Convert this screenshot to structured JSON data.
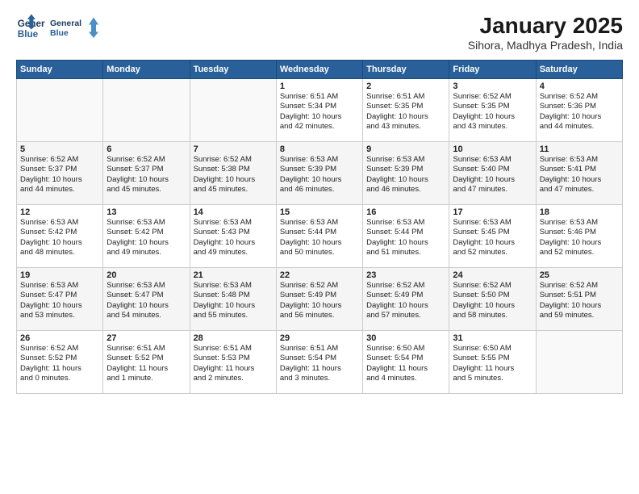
{
  "logo": {
    "line1": "General",
    "line2": "Blue"
  },
  "header": {
    "month_year": "January 2025",
    "location": "Sihora, Madhya Pradesh, India"
  },
  "days_of_week": [
    "Sunday",
    "Monday",
    "Tuesday",
    "Wednesday",
    "Thursday",
    "Friday",
    "Saturday"
  ],
  "weeks": [
    [
      {
        "day": "",
        "info": ""
      },
      {
        "day": "",
        "info": ""
      },
      {
        "day": "",
        "info": ""
      },
      {
        "day": "1",
        "info": "Sunrise: 6:51 AM\nSunset: 5:34 PM\nDaylight: 10 hours\nand 42 minutes."
      },
      {
        "day": "2",
        "info": "Sunrise: 6:51 AM\nSunset: 5:35 PM\nDaylight: 10 hours\nand 43 minutes."
      },
      {
        "day": "3",
        "info": "Sunrise: 6:52 AM\nSunset: 5:35 PM\nDaylight: 10 hours\nand 43 minutes."
      },
      {
        "day": "4",
        "info": "Sunrise: 6:52 AM\nSunset: 5:36 PM\nDaylight: 10 hours\nand 44 minutes."
      }
    ],
    [
      {
        "day": "5",
        "info": "Sunrise: 6:52 AM\nSunset: 5:37 PM\nDaylight: 10 hours\nand 44 minutes."
      },
      {
        "day": "6",
        "info": "Sunrise: 6:52 AM\nSunset: 5:37 PM\nDaylight: 10 hours\nand 45 minutes."
      },
      {
        "day": "7",
        "info": "Sunrise: 6:52 AM\nSunset: 5:38 PM\nDaylight: 10 hours\nand 45 minutes."
      },
      {
        "day": "8",
        "info": "Sunrise: 6:53 AM\nSunset: 5:39 PM\nDaylight: 10 hours\nand 46 minutes."
      },
      {
        "day": "9",
        "info": "Sunrise: 6:53 AM\nSunset: 5:39 PM\nDaylight: 10 hours\nand 46 minutes."
      },
      {
        "day": "10",
        "info": "Sunrise: 6:53 AM\nSunset: 5:40 PM\nDaylight: 10 hours\nand 47 minutes."
      },
      {
        "day": "11",
        "info": "Sunrise: 6:53 AM\nSunset: 5:41 PM\nDaylight: 10 hours\nand 47 minutes."
      }
    ],
    [
      {
        "day": "12",
        "info": "Sunrise: 6:53 AM\nSunset: 5:42 PM\nDaylight: 10 hours\nand 48 minutes."
      },
      {
        "day": "13",
        "info": "Sunrise: 6:53 AM\nSunset: 5:42 PM\nDaylight: 10 hours\nand 49 minutes."
      },
      {
        "day": "14",
        "info": "Sunrise: 6:53 AM\nSunset: 5:43 PM\nDaylight: 10 hours\nand 49 minutes."
      },
      {
        "day": "15",
        "info": "Sunrise: 6:53 AM\nSunset: 5:44 PM\nDaylight: 10 hours\nand 50 minutes."
      },
      {
        "day": "16",
        "info": "Sunrise: 6:53 AM\nSunset: 5:44 PM\nDaylight: 10 hours\nand 51 minutes."
      },
      {
        "day": "17",
        "info": "Sunrise: 6:53 AM\nSunset: 5:45 PM\nDaylight: 10 hours\nand 52 minutes."
      },
      {
        "day": "18",
        "info": "Sunrise: 6:53 AM\nSunset: 5:46 PM\nDaylight: 10 hours\nand 52 minutes."
      }
    ],
    [
      {
        "day": "19",
        "info": "Sunrise: 6:53 AM\nSunset: 5:47 PM\nDaylight: 10 hours\nand 53 minutes."
      },
      {
        "day": "20",
        "info": "Sunrise: 6:53 AM\nSunset: 5:47 PM\nDaylight: 10 hours\nand 54 minutes."
      },
      {
        "day": "21",
        "info": "Sunrise: 6:53 AM\nSunset: 5:48 PM\nDaylight: 10 hours\nand 55 minutes."
      },
      {
        "day": "22",
        "info": "Sunrise: 6:52 AM\nSunset: 5:49 PM\nDaylight: 10 hours\nand 56 minutes."
      },
      {
        "day": "23",
        "info": "Sunrise: 6:52 AM\nSunset: 5:49 PM\nDaylight: 10 hours\nand 57 minutes."
      },
      {
        "day": "24",
        "info": "Sunrise: 6:52 AM\nSunset: 5:50 PM\nDaylight: 10 hours\nand 58 minutes."
      },
      {
        "day": "25",
        "info": "Sunrise: 6:52 AM\nSunset: 5:51 PM\nDaylight: 10 hours\nand 59 minutes."
      }
    ],
    [
      {
        "day": "26",
        "info": "Sunrise: 6:52 AM\nSunset: 5:52 PM\nDaylight: 11 hours\nand 0 minutes."
      },
      {
        "day": "27",
        "info": "Sunrise: 6:51 AM\nSunset: 5:52 PM\nDaylight: 11 hours\nand 1 minute."
      },
      {
        "day": "28",
        "info": "Sunrise: 6:51 AM\nSunset: 5:53 PM\nDaylight: 11 hours\nand 2 minutes."
      },
      {
        "day": "29",
        "info": "Sunrise: 6:51 AM\nSunset: 5:54 PM\nDaylight: 11 hours\nand 3 minutes."
      },
      {
        "day": "30",
        "info": "Sunrise: 6:50 AM\nSunset: 5:54 PM\nDaylight: 11 hours\nand 4 minutes."
      },
      {
        "day": "31",
        "info": "Sunrise: 6:50 AM\nSunset: 5:55 PM\nDaylight: 11 hours\nand 5 minutes."
      },
      {
        "day": "",
        "info": ""
      }
    ]
  ]
}
